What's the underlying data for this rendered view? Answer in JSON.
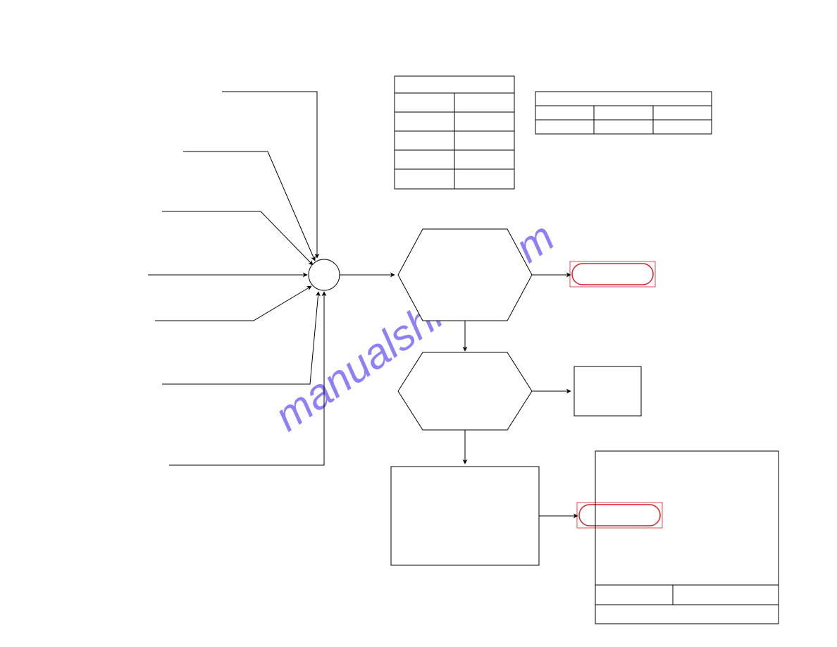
{
  "diagram": {
    "watermark_text": "manualshive.com",
    "shapes": {
      "input_branches": 7,
      "circle_junction": true,
      "decision_hexagons": 2,
      "process_box": 1,
      "terminator_ovals": 2,
      "output_box": 1,
      "tables": {
        "table_left": {
          "header_rows": 1,
          "body_rows": 5,
          "cols": 2
        },
        "table_right": {
          "header_rows": 1,
          "body_rows": 2,
          "cols": 3
        }
      },
      "title_block": {
        "rows": [
          [
            "",
            ""
          ],
          [
            "",
            "",
            ""
          ],
          [
            ""
          ]
        ]
      }
    },
    "colors": {
      "stroke": "#000000",
      "oval_stroke": "#d4202a",
      "watermark": "#7b6cf6"
    }
  }
}
